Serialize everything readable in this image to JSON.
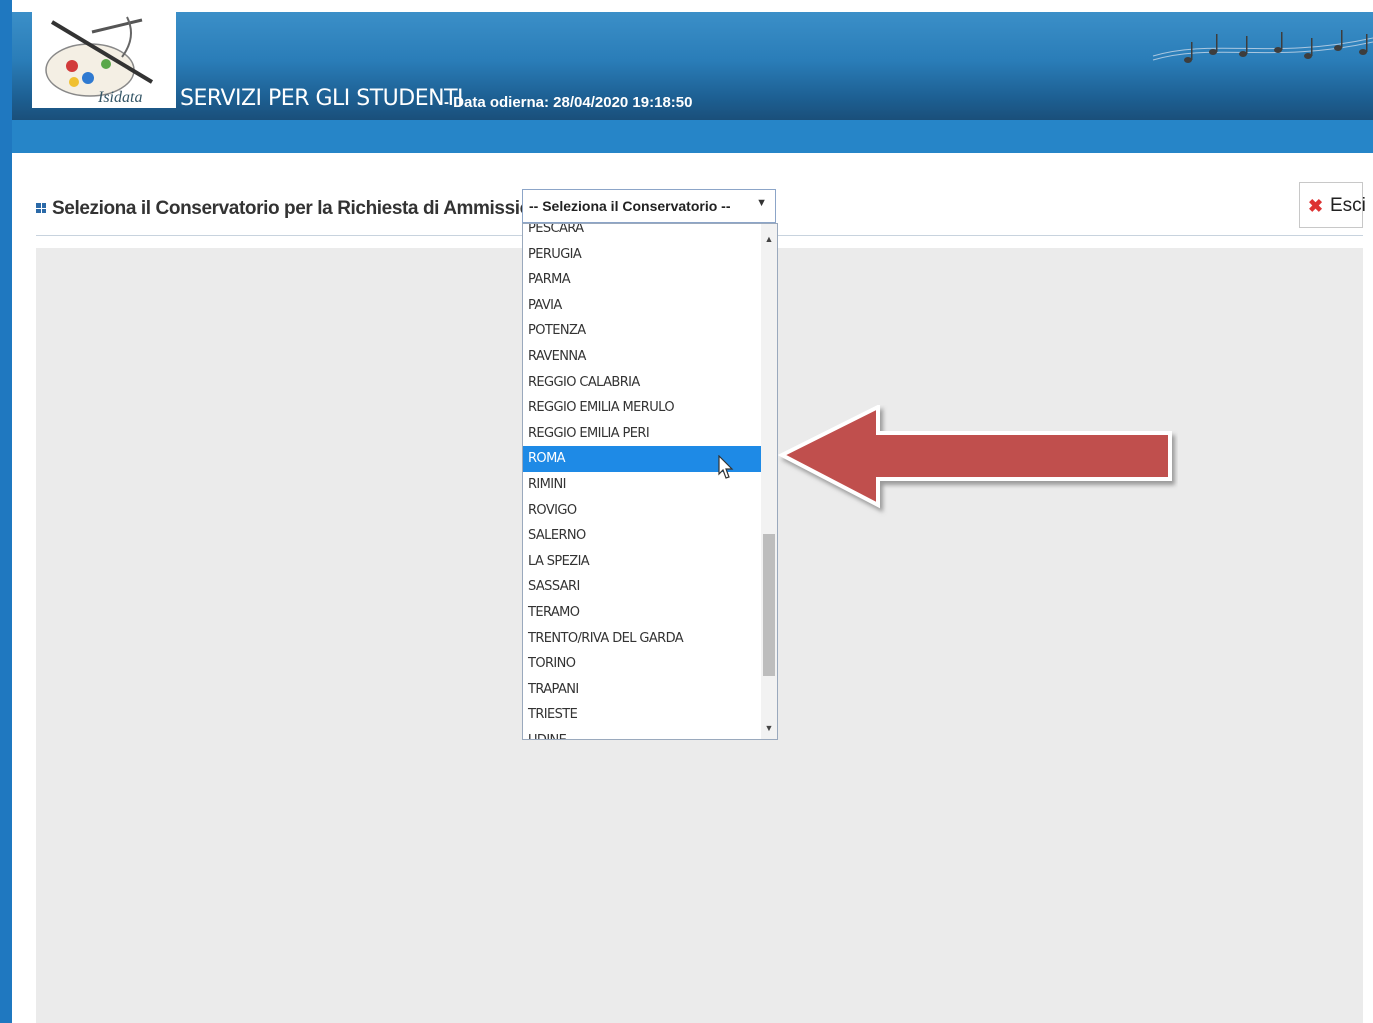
{
  "header": {
    "app_title": "SERVIZI PER GLI STUDENTI",
    "date_text": "- Data odierna: 28/04/2020 19:18:50",
    "logo_text": "Isidata"
  },
  "toolbar": {
    "label": "Seleziona il Conservatorio per la Richiesta di Ammissione:",
    "select_value": "-- Seleziona il Conservatorio --",
    "exit_label": "Esci"
  },
  "dropdown": {
    "options": [
      "PESCARA",
      "PERUGIA",
      "PARMA",
      "PAVIA",
      "POTENZA",
      "RAVENNA",
      "REGGIO CALABRIA",
      "REGGIO EMILIA MERULO",
      "REGGIO EMILIA PERI",
      "ROMA",
      "RIMINI",
      "ROVIGO",
      "SALERNO",
      "LA SPEZIA",
      "SASSARI",
      "TERAMO",
      "TRENTO/RIVA DEL GARDA",
      "TORINO",
      "TRAPANI",
      "TRIESTE",
      "UDINE"
    ],
    "highlighted": "ROMA"
  },
  "colors": {
    "header_blue": "#2a7db8",
    "highlight_blue": "#1e8ae6",
    "annotation_arrow": "#c0504d"
  },
  "icons": [
    "palette-logo-icon",
    "music-notes-icon",
    "exit-x-icon",
    "mouse-pointer-icon",
    "red-arrow-annotation"
  ]
}
